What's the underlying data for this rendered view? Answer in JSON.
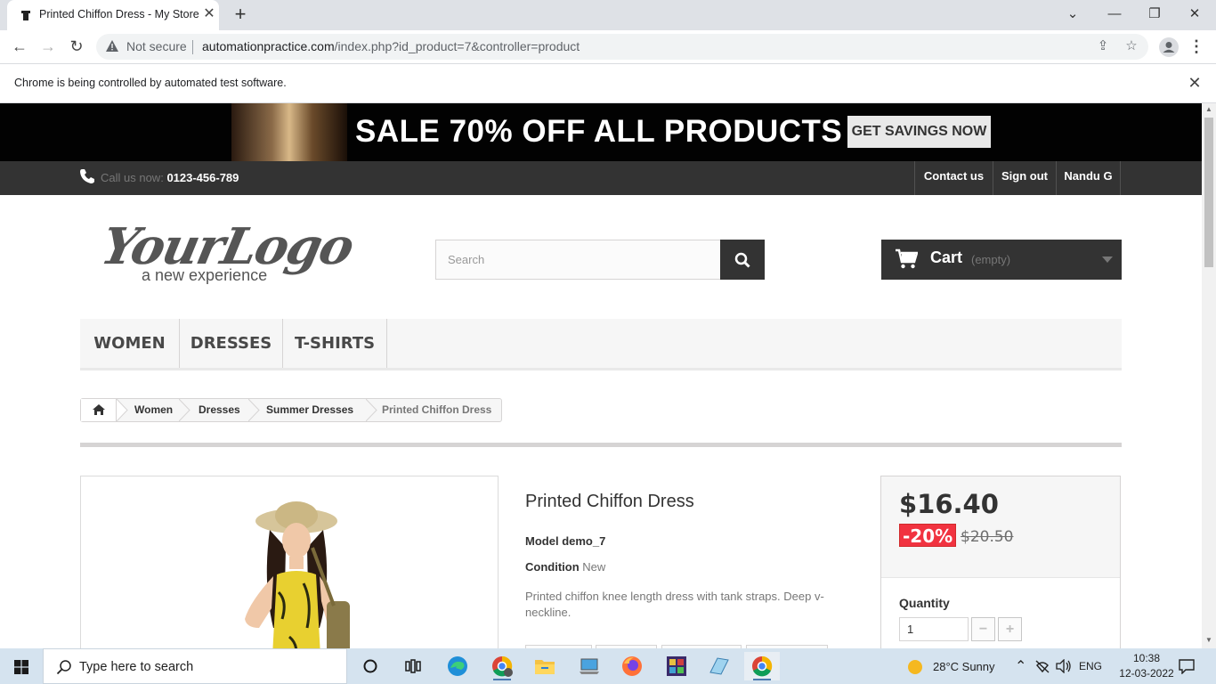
{
  "browser": {
    "tab_title": "Printed Chiffon Dress - My Store",
    "not_secure_label": "Not secure",
    "url_host": "automationpractice.com",
    "url_path": "/index.php?id_product=7&controller=product",
    "infobar_text": "Chrome is being controlled by automated test software."
  },
  "site": {
    "banner_text": "SALE 70% OFF ALL PRODUCTS",
    "banner_button": "GET SAVINGS NOW",
    "call_label": "Call us now:",
    "call_number": "0123-456-789",
    "top_links": [
      "Contact us",
      "Sign out",
      "Nandu G"
    ],
    "logo_main": "YourLogo",
    "logo_sub": "a new experience",
    "search_placeholder": "Search",
    "cart_label": "Cart",
    "cart_status": "(empty)",
    "menu": [
      "WOMEN",
      "DRESSES",
      "T-SHIRTS"
    ],
    "breadcrumb": [
      "Women",
      "Dresses",
      "Summer Dresses",
      "Printed Chiffon Dress"
    ]
  },
  "product": {
    "title": "Printed Chiffon Dress",
    "model_label": "Model",
    "model_value": "demo_7",
    "condition_label": "Condition",
    "condition_value": "New",
    "description": "Printed chiffon knee length dress with tank straps. Deep v-neckline.",
    "price": "$16.40",
    "reduction": "-20%",
    "old_price": "$20.50",
    "quantity_label": "Quantity",
    "quantity_value": "1"
  },
  "taskbar": {
    "search_text": "Type here to search",
    "weather": "28°C  Sunny",
    "language": "ENG",
    "time": "10:38",
    "date": "12-03-2022"
  },
  "colors": {
    "banner_bg": "#020202",
    "nav_bg": "#333333",
    "reduction_bg": "#f13340",
    "taskbar_bg": "#d5e3ef"
  }
}
